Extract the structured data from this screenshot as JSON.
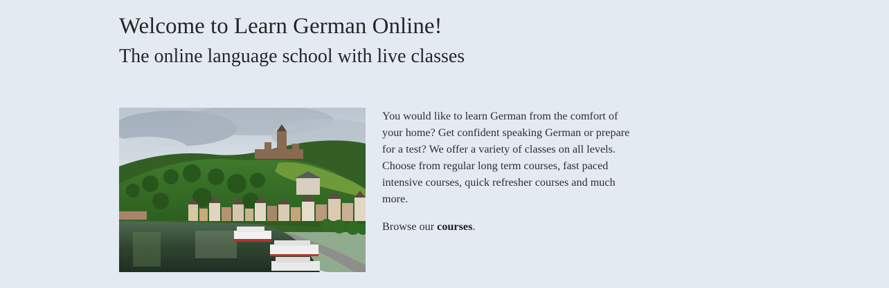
{
  "hero": {
    "title": "Welcome to Learn German Online!",
    "subtitle": "The online language school with live classes"
  },
  "intro": {
    "image_description": "Cochem castle above the Moselle river",
    "paragraph": "You would like to learn German from the comfort of your home? Get confident speaking German or prepare for a test? We offer a variety of classes on all levels. Choose from regular long term courses, fast paced intensive courses, quick refresher courses and much more.",
    "browse_prefix": "Browse our ",
    "browse_link": "courses",
    "browse_suffix": "."
  },
  "colors": {
    "background": "#e4eaf2",
    "text": "#2b2b2b"
  }
}
